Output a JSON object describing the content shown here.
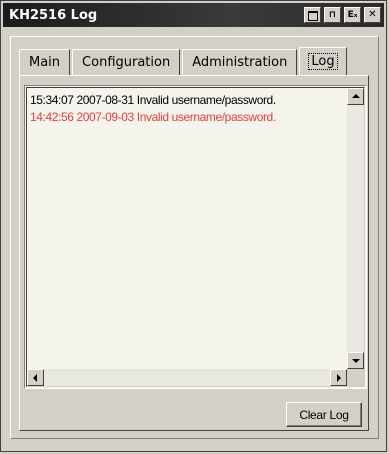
{
  "window": {
    "title": "KH2516 Log",
    "title_buttons": [
      "restore-icon",
      "pin-icon",
      "exit-icon",
      "close-icon"
    ],
    "title_button_glyphs": {
      "pin": "⊓",
      "exit": "Eₓ",
      "close": "✕"
    }
  },
  "tabs": [
    {
      "label": "Main",
      "active": false
    },
    {
      "label": "Configuration",
      "active": false
    },
    {
      "label": "Administration",
      "active": false
    },
    {
      "label": "Log",
      "active": true
    }
  ],
  "log": {
    "entries": [
      {
        "text": "15:34:07 2007-08-31 Invalid username/password.",
        "color": "#000000"
      },
      {
        "text": "14:42:56 2007-09-03 Invalid username/password.",
        "color": "#e04040"
      }
    ]
  },
  "buttons": {
    "clear_log": "Clear Log"
  },
  "colors": {
    "titlebar": "#1c1c1c",
    "face": "#d4d0c8",
    "log_background": "#f4f4ec",
    "error_text": "#e04040"
  }
}
